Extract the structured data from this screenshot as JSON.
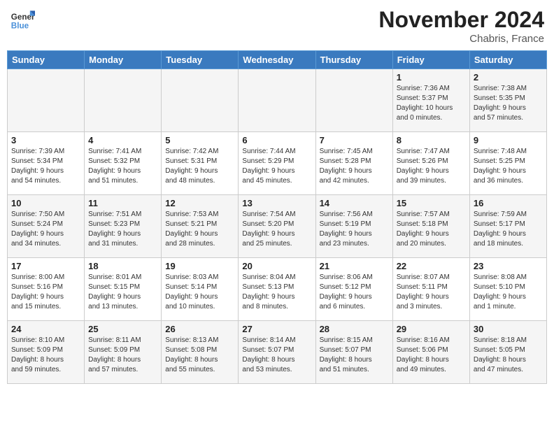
{
  "logo": {
    "line1": "General",
    "line2": "Blue"
  },
  "title": "November 2024",
  "location": "Chabris, France",
  "days_of_week": [
    "Sunday",
    "Monday",
    "Tuesday",
    "Wednesday",
    "Thursday",
    "Friday",
    "Saturday"
  ],
  "weeks": [
    [
      {
        "day": "",
        "info": ""
      },
      {
        "day": "",
        "info": ""
      },
      {
        "day": "",
        "info": ""
      },
      {
        "day": "",
        "info": ""
      },
      {
        "day": "",
        "info": ""
      },
      {
        "day": "1",
        "info": "Sunrise: 7:36 AM\nSunset: 5:37 PM\nDaylight: 10 hours\nand 0 minutes."
      },
      {
        "day": "2",
        "info": "Sunrise: 7:38 AM\nSunset: 5:35 PM\nDaylight: 9 hours\nand 57 minutes."
      }
    ],
    [
      {
        "day": "3",
        "info": "Sunrise: 7:39 AM\nSunset: 5:34 PM\nDaylight: 9 hours\nand 54 minutes."
      },
      {
        "day": "4",
        "info": "Sunrise: 7:41 AM\nSunset: 5:32 PM\nDaylight: 9 hours\nand 51 minutes."
      },
      {
        "day": "5",
        "info": "Sunrise: 7:42 AM\nSunset: 5:31 PM\nDaylight: 9 hours\nand 48 minutes."
      },
      {
        "day": "6",
        "info": "Sunrise: 7:44 AM\nSunset: 5:29 PM\nDaylight: 9 hours\nand 45 minutes."
      },
      {
        "day": "7",
        "info": "Sunrise: 7:45 AM\nSunset: 5:28 PM\nDaylight: 9 hours\nand 42 minutes."
      },
      {
        "day": "8",
        "info": "Sunrise: 7:47 AM\nSunset: 5:26 PM\nDaylight: 9 hours\nand 39 minutes."
      },
      {
        "day": "9",
        "info": "Sunrise: 7:48 AM\nSunset: 5:25 PM\nDaylight: 9 hours\nand 36 minutes."
      }
    ],
    [
      {
        "day": "10",
        "info": "Sunrise: 7:50 AM\nSunset: 5:24 PM\nDaylight: 9 hours\nand 34 minutes."
      },
      {
        "day": "11",
        "info": "Sunrise: 7:51 AM\nSunset: 5:23 PM\nDaylight: 9 hours\nand 31 minutes."
      },
      {
        "day": "12",
        "info": "Sunrise: 7:53 AM\nSunset: 5:21 PM\nDaylight: 9 hours\nand 28 minutes."
      },
      {
        "day": "13",
        "info": "Sunrise: 7:54 AM\nSunset: 5:20 PM\nDaylight: 9 hours\nand 25 minutes."
      },
      {
        "day": "14",
        "info": "Sunrise: 7:56 AM\nSunset: 5:19 PM\nDaylight: 9 hours\nand 23 minutes."
      },
      {
        "day": "15",
        "info": "Sunrise: 7:57 AM\nSunset: 5:18 PM\nDaylight: 9 hours\nand 20 minutes."
      },
      {
        "day": "16",
        "info": "Sunrise: 7:59 AM\nSunset: 5:17 PM\nDaylight: 9 hours\nand 18 minutes."
      }
    ],
    [
      {
        "day": "17",
        "info": "Sunrise: 8:00 AM\nSunset: 5:16 PM\nDaylight: 9 hours\nand 15 minutes."
      },
      {
        "day": "18",
        "info": "Sunrise: 8:01 AM\nSunset: 5:15 PM\nDaylight: 9 hours\nand 13 minutes."
      },
      {
        "day": "19",
        "info": "Sunrise: 8:03 AM\nSunset: 5:14 PM\nDaylight: 9 hours\nand 10 minutes."
      },
      {
        "day": "20",
        "info": "Sunrise: 8:04 AM\nSunset: 5:13 PM\nDaylight: 9 hours\nand 8 minutes."
      },
      {
        "day": "21",
        "info": "Sunrise: 8:06 AM\nSunset: 5:12 PM\nDaylight: 9 hours\nand 6 minutes."
      },
      {
        "day": "22",
        "info": "Sunrise: 8:07 AM\nSunset: 5:11 PM\nDaylight: 9 hours\nand 3 minutes."
      },
      {
        "day": "23",
        "info": "Sunrise: 8:08 AM\nSunset: 5:10 PM\nDaylight: 9 hours\nand 1 minute."
      }
    ],
    [
      {
        "day": "24",
        "info": "Sunrise: 8:10 AM\nSunset: 5:09 PM\nDaylight: 8 hours\nand 59 minutes."
      },
      {
        "day": "25",
        "info": "Sunrise: 8:11 AM\nSunset: 5:09 PM\nDaylight: 8 hours\nand 57 minutes."
      },
      {
        "day": "26",
        "info": "Sunrise: 8:13 AM\nSunset: 5:08 PM\nDaylight: 8 hours\nand 55 minutes."
      },
      {
        "day": "27",
        "info": "Sunrise: 8:14 AM\nSunset: 5:07 PM\nDaylight: 8 hours\nand 53 minutes."
      },
      {
        "day": "28",
        "info": "Sunrise: 8:15 AM\nSunset: 5:07 PM\nDaylight: 8 hours\nand 51 minutes."
      },
      {
        "day": "29",
        "info": "Sunrise: 8:16 AM\nSunset: 5:06 PM\nDaylight: 8 hours\nand 49 minutes."
      },
      {
        "day": "30",
        "info": "Sunrise: 8:18 AM\nSunset: 5:05 PM\nDaylight: 8 hours\nand 47 minutes."
      }
    ]
  ]
}
